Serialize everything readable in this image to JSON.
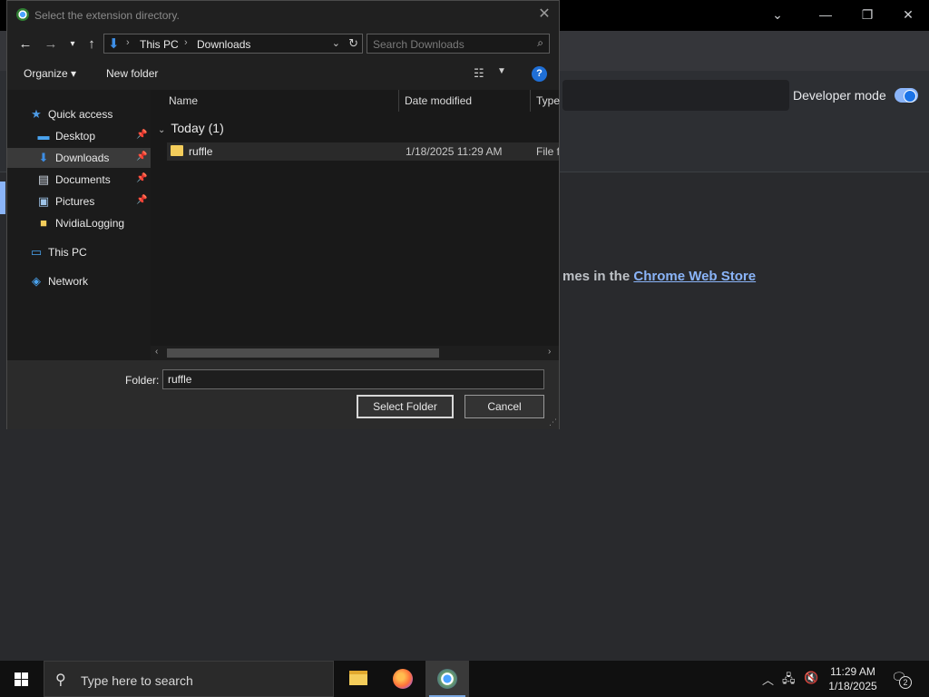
{
  "dialog": {
    "title": "Select the extension directory.",
    "address": {
      "crumbs": [
        "This PC",
        "Downloads"
      ]
    },
    "search_placeholder": "Search Downloads",
    "toolbar": {
      "organize": "Organize ▾",
      "new_folder": "New folder",
      "help": "?"
    },
    "nav_pane": {
      "quick_access": "Quick access",
      "items": [
        "Desktop",
        "Downloads",
        "Documents",
        "Pictures",
        "NvidiaLogging"
      ],
      "this_pc": "This PC",
      "network": "Network"
    },
    "columns": {
      "name": "Name",
      "date_modified": "Date modified",
      "type": "Type"
    },
    "group": "Today (1)",
    "files": [
      {
        "name": "ruffle",
        "date": "1/18/2025 11:29 AM",
        "type": "File folder"
      }
    ],
    "folder_label": "Folder:",
    "folder_value": "ruffle",
    "buttons": {
      "select": "Select Folder",
      "cancel": "Cancel"
    }
  },
  "background": {
    "developer_mode": "Developer mode",
    "store_text": "mes in the ",
    "store_link": "Chrome Web Store"
  },
  "taskbar": {
    "search_text": "Type here to search",
    "time": "11:29 AM",
    "date": "1/18/2025",
    "notifications": "2"
  },
  "colors": {
    "accent": "#8ab4f8",
    "folder": "#f4cd5b",
    "help": "#1f6fd6"
  }
}
